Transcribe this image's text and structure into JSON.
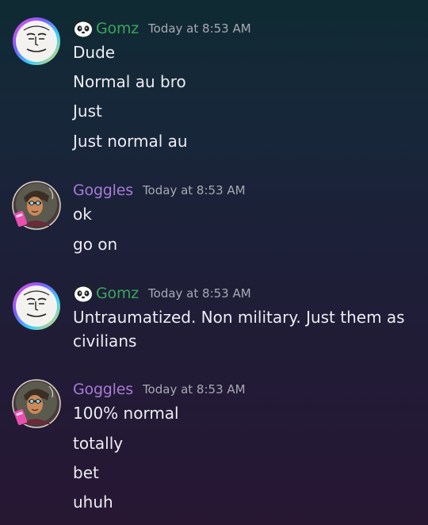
{
  "messages": [
    {
      "author": "Gomz",
      "author_color": "#3ba55c",
      "timestamp": "Today at 8:53 AM",
      "avatar_icon": "sketch-face-avatar",
      "badge_icon": "panda-emoji",
      "lines": [
        "Dude",
        "Normal au bro",
        "Just",
        "Just normal au"
      ]
    },
    {
      "author": "Goggles",
      "author_color": "#a77bd6",
      "timestamp": "Today at 8:53 AM",
      "avatar_icon": "drawn-character-avatar",
      "lines": [
        "ok",
        "go on"
      ]
    },
    {
      "author": "Gomz",
      "author_color": "#3ba55c",
      "timestamp": "Today at 8:53 AM",
      "avatar_icon": "sketch-face-avatar",
      "badge_icon": "panda-emoji",
      "lines": [
        "Untraumatized. Non military. Just them as civilians"
      ]
    },
    {
      "author": "Goggles",
      "author_color": "#a77bd6",
      "timestamp": "Today at 8:53 AM",
      "avatar_icon": "drawn-character-avatar",
      "lines": [
        "100% normal",
        "totally",
        "bet",
        "uhuh"
      ]
    }
  ]
}
